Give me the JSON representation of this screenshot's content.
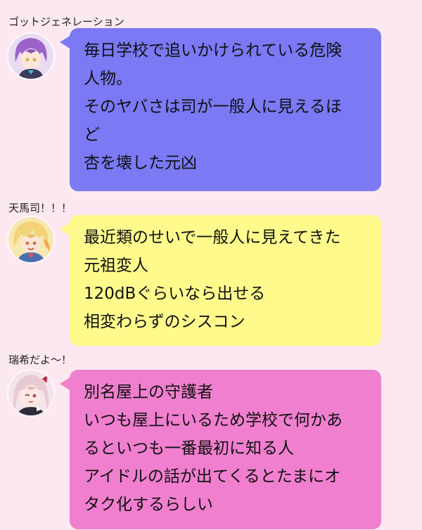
{
  "messages": [
    {
      "sender": "ゴットジェネレーション",
      "avatar_icon": "purple-hair-character-avatar",
      "bubble_color": "#7b79f4",
      "lines": [
        "毎日学校で追いかけられている危険",
        "人物。",
        "そのヤバさは司が一般人に見えるほ",
        "ど",
        "杏を壊した元凶"
      ]
    },
    {
      "sender": "天馬司！！！",
      "avatar_icon": "blonde-hair-character-avatar",
      "bubble_color": "#fefb8c",
      "lines": [
        "最近類のせいで一般人に見えてきた",
        "元祖変人",
        "120dBぐらいなら出せる",
        "相変わらずのシスコン"
      ]
    },
    {
      "sender": "瑞希だよ〜！",
      "avatar_icon": "pink-hair-character-avatar",
      "bubble_color": "#f07fcf",
      "lines": [
        "別名屋上の守護者",
        "いつも屋上にいるため学校で何かあ",
        "るといつも一番最初に知る人",
        "アイドルの話が出てくるとたまにオ",
        "タク化するらしい"
      ]
    }
  ]
}
